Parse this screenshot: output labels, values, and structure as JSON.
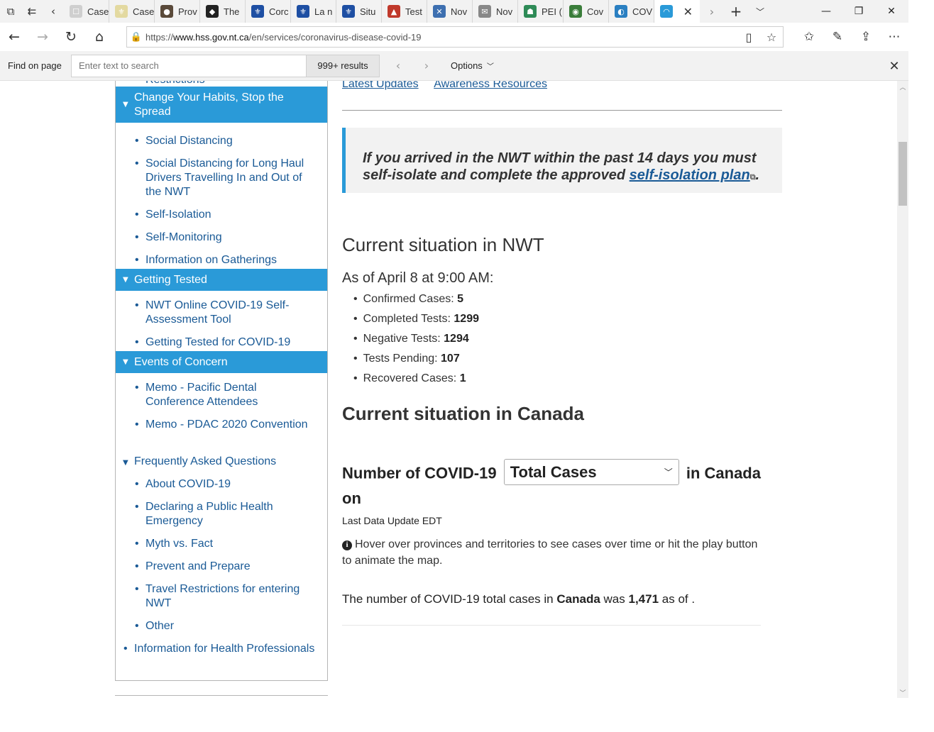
{
  "browser": {
    "tabs": [
      {
        "label": "Case",
        "fav_color": "#cfcfcf",
        "fav_glyph": "☐"
      },
      {
        "label": "Case",
        "fav_color": "#e3d9a0",
        "fav_glyph": "⚜"
      },
      {
        "label": "Prov",
        "fav_color": "#5a4a3a",
        "fav_glyph": "●"
      },
      {
        "label": "The",
        "fav_color": "#222222",
        "fav_glyph": "◆"
      },
      {
        "label": "Corc",
        "fav_color": "#1e4fa3",
        "fav_glyph": "⚜"
      },
      {
        "label": "La n",
        "fav_color": "#1e4fa3",
        "fav_glyph": "⚜"
      },
      {
        "label": "Situ",
        "fav_color": "#1e4fa3",
        "fav_glyph": "⚜"
      },
      {
        "label": "Test",
        "fav_color": "#c0392b",
        "fav_glyph": "▲"
      },
      {
        "label": "Nov",
        "fav_color": "#3d6fb0",
        "fav_glyph": "✕"
      },
      {
        "label": "Nov",
        "fav_color": "#888888",
        "fav_glyph": "✉"
      },
      {
        "label": "PEI (",
        "fav_color": "#2e8b57",
        "fav_glyph": "☗"
      },
      {
        "label": "Cov",
        "fav_color": "#3a7d3a",
        "fav_glyph": "◉"
      },
      {
        "label": "COV",
        "fav_color": "#2a7fc1",
        "fav_glyph": "◐"
      }
    ],
    "active_tab_fav_color": "#2a9ad8",
    "url_prefix": "https://",
    "url_domain": "www.hss.gov.nt.ca",
    "url_path": "/en/services/coronavirus-disease-covid-19"
  },
  "findbar": {
    "label": "Find on page",
    "placeholder": "Enter text to search",
    "count": "999+ results",
    "options_label": "Options"
  },
  "sidebar": {
    "cut_item": "Restrictions",
    "sections": [
      {
        "label": "Change Your Habits, Stop the Spread"
      },
      {
        "label": "Getting Tested"
      },
      {
        "label": "Events of Concern"
      }
    ],
    "habits_items": [
      "Social Distancing",
      "Social Distancing for Long Haul Drivers Travelling In and Out of the NWT",
      "Self-Isolation",
      "Self-Monitoring",
      "Information on Gatherings"
    ],
    "testing_items": [
      "NWT Online COVID-19 Self-Assessment Tool",
      "Getting Tested for COVID-19"
    ],
    "events_items": [
      "Memo - Pacific Dental Conference Attendees",
      "Memo - PDAC 2020 Convention"
    ],
    "faq_label": "Frequently Asked Questions",
    "faq_items": [
      "About COVID-19",
      "Declaring a Public Health Emergency",
      "Myth vs. Fact",
      "Prevent and Prepare",
      "Travel Restrictions for entering NWT",
      "Other"
    ],
    "health_prof": "Information for Health Professionals"
  },
  "main": {
    "links": [
      "Latest Updates",
      "Awareness Resources"
    ],
    "notice_text": "If you arrived in the NWT within the past 14 days you must self-isolate and complete the approved",
    "notice_link": "self-isolation plan",
    "notice_end": ".",
    "nwt_heading": "Current situation in NWT",
    "as_of": "As of April 8 at 9:00 AM:",
    "stats": [
      {
        "label": "Confirmed Cases:",
        "value": "5"
      },
      {
        "label": "Completed Tests:",
        "value": "1299"
      },
      {
        "label": "Negative Tests:",
        "value": "1294"
      },
      {
        "label": "Tests Pending:",
        "value": "107"
      },
      {
        "label": "Recovered Cases:",
        "value": "1"
      }
    ],
    "canada_heading": "Current situation in Canada",
    "num_prefix": "Number of COVID-19",
    "select_value": "Total Cases",
    "num_suffix": "in Canada on",
    "last_update": "Last Data Update EDT",
    "hover_note": "Hover over provinces and territories to see cases over time or hit the play button to animate the map.",
    "total_prefix": "The number of COVID-19 total cases in",
    "total_region": "Canada",
    "total_mid": "was",
    "total_value": "1,471",
    "total_suffix": "as of ."
  }
}
